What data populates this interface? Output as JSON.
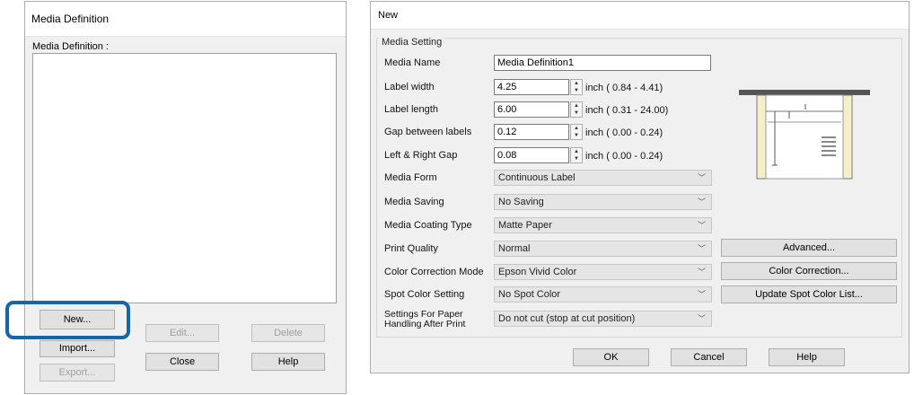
{
  "left_dialog": {
    "title": "Media Definition",
    "list_label": "Media Definition :",
    "buttons": {
      "new": "New...",
      "edit": "Edit...",
      "delete": "Delete",
      "import": "Import...",
      "close": "Close",
      "help": "Help",
      "export": "Export..."
    }
  },
  "right_dialog": {
    "title": "New",
    "group_title": "Media Setting",
    "fields": {
      "media_name": {
        "label": "Media Name",
        "value": "Media Definition1"
      },
      "label_width": {
        "label": "Label width",
        "value": "4.25",
        "range": "inch ( 0.84 -  4.41)"
      },
      "label_length": {
        "label": "Label length",
        "value": "6.00",
        "range": "inch ( 0.31 - 24.00)"
      },
      "gap_between": {
        "label": "Gap between labels",
        "value": "0.12",
        "range": "inch ( 0.00 -  0.24)"
      },
      "lr_gap": {
        "label": "Left & Right Gap",
        "value": "0.08",
        "range": "inch ( 0.00 -  0.24)"
      }
    },
    "combos": {
      "media_form": {
        "label": "Media Form",
        "value": "Continuous Label"
      },
      "media_saving": {
        "label": "Media Saving",
        "value": "No Saving"
      },
      "coating": {
        "label": "Media Coating Type",
        "value": "Matte Paper"
      },
      "print_quality": {
        "label": "Print Quality",
        "value": "Normal"
      },
      "color_mode": {
        "label": "Color Correction Mode",
        "value": "Epson Vivid Color"
      },
      "spot_color": {
        "label": "Spot Color Setting",
        "value": "No Spot Color"
      },
      "paper_handling": {
        "label": "Settings For Paper Handling After Print",
        "value": "Do not cut (stop at cut position)"
      }
    },
    "side_buttons": {
      "advanced": "Advanced...",
      "color_correction": "Color Correction...",
      "update_spot": "Update Spot Color List..."
    },
    "footer_buttons": {
      "ok": "OK",
      "cancel": "Cancel",
      "help": "Help"
    }
  },
  "colors": {
    "highlight_ring": "#1565a8",
    "label_paper": "#f3f0c8"
  }
}
